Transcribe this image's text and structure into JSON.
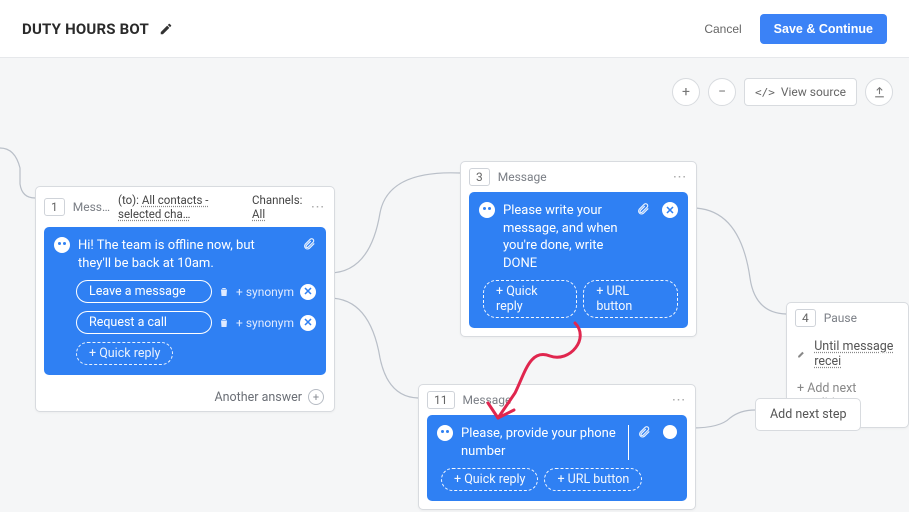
{
  "header": {
    "title": "DUTY HOURS BOT",
    "cancel": "Cancel",
    "save": "Save & Continue"
  },
  "toolbar": {
    "view_source": "View source"
  },
  "node1": {
    "num": "1",
    "label": "Mess…",
    "to_prefix": "(to):",
    "to_value": "All contacts - selected cha…",
    "channels_prefix": "Channels:",
    "channels_value": "All",
    "text": "Hi! The team is offline now, but they'll be back at 10am.",
    "reply1": "Leave a message",
    "reply2": "Request a call",
    "synonym": "+ synonym",
    "quick_reply": "+  Quick reply",
    "footer": "Another answer"
  },
  "node3": {
    "num": "3",
    "label": "Message",
    "text": "Please write your message, and when you're done, write DONE",
    "quick_reply": "+  Quick reply",
    "url_button": "+  URL button"
  },
  "node11": {
    "num": "11",
    "label": "Message",
    "text": "Please, provide your phone number",
    "quick_reply": "+  Quick reply",
    "url_button": "+  URL button"
  },
  "node4": {
    "num": "4",
    "label": "Pause",
    "until": "Until message recei",
    "add_cond": "+   Add next condition"
  },
  "add_step": "Add next step"
}
